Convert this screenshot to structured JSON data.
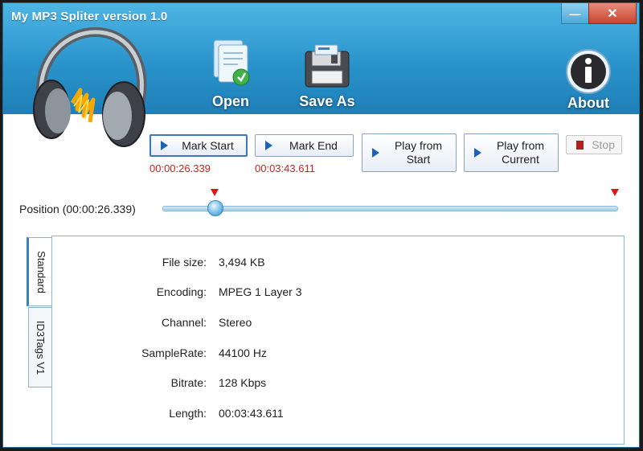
{
  "window": {
    "title": "My MP3 Spliter  version 1.0",
    "minimize_glyph": "—",
    "close_glyph": "✕"
  },
  "toolbar": {
    "open_label": "Open",
    "save_as_label": "Save As",
    "about_label": "About",
    "about_glyph": "i"
  },
  "buttons": {
    "mark_start": "Mark Start",
    "mark_end": "Mark End",
    "play_from_start_line1": "Play from",
    "play_from_start_line2": "Start",
    "play_from_current_line1": "Play from",
    "play_from_current_line2": "Current",
    "stop": "Stop"
  },
  "times": {
    "mark_start": "00:00:26.339",
    "mark_end": "00:03:43.611"
  },
  "position": {
    "label": "Position (00:00:26.339)",
    "progress_fraction": 0.117
  },
  "tabs": [
    {
      "label": "Standard",
      "active": true
    },
    {
      "label": "ID3Tags V1",
      "active": false
    }
  ],
  "file_info": [
    {
      "key": "File size:",
      "value": "3,494 KB"
    },
    {
      "key": "Encoding:",
      "value": "MPEG 1 Layer 3"
    },
    {
      "key": "Channel:",
      "value": "Stereo"
    },
    {
      "key": "SampleRate:",
      "value": "44100 Hz"
    },
    {
      "key": "Bitrate:",
      "value": "128 Kbps"
    },
    {
      "key": "Length:",
      "value": "00:03:43.611"
    }
  ],
  "colors": {
    "header_blue": "#2a93cb",
    "time_red": "#d21e1e",
    "accent_blue": "#1b63b8"
  }
}
